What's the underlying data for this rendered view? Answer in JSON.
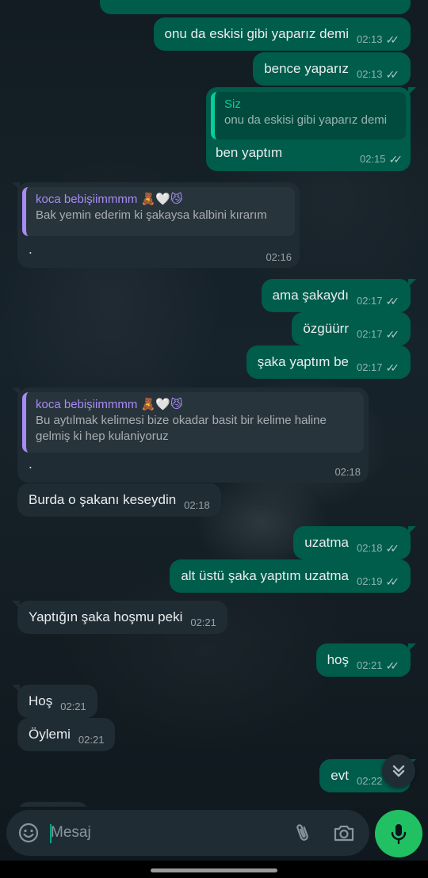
{
  "colors": {
    "outgoing_bubble": "#005c4b",
    "incoming_bubble": "#202c33",
    "accent": "#21c063",
    "contact_name": "#a88bf5",
    "self_name": "#06cf9c"
  },
  "messages": [
    {
      "text": "onu da eskisi gibi yaparız demi",
      "time": "02:13",
      "dir": "out"
    },
    {
      "text": "bence yaparız",
      "time": "02:13",
      "dir": "out"
    },
    {
      "quote_name": "Siz",
      "quote_text": "onu da eskisi gibi yaparız demi",
      "text": "ben yaptım",
      "time": "02:15",
      "dir": "out"
    },
    {
      "quote_name": "koca bebişiimmmm 🧸🤍😼",
      "quote_text": "Bak yemin ederim ki şakaysa kalbini kırarım",
      "text": ".",
      "time": "02:16",
      "dir": "in"
    },
    {
      "text": "ama şakaydı",
      "time": "02:17",
      "dir": "out"
    },
    {
      "text": "özgüürr",
      "time": "02:17",
      "dir": "out"
    },
    {
      "text": "şaka yaptım be",
      "time": "02:17",
      "dir": "out"
    },
    {
      "quote_name": "koca bebişiimmmm 🧸🤍😼",
      "quote_text": "Bu aytılmak kelimesi bize okadar basit bir kelime haline gelmiş ki hep kulaniyoruz",
      "text": ".",
      "time": "02:18",
      "dir": "in"
    },
    {
      "text": "Burda o şakanı keseydin",
      "time": "02:18",
      "dir": "in"
    },
    {
      "text": "uzatma",
      "time": "02:18",
      "dir": "out"
    },
    {
      "text": "alt üstü şaka yaptım uzatma",
      "time": "02:19",
      "dir": "out"
    },
    {
      "text": "Yaptığın şaka hoşmu peki",
      "time": "02:21",
      "dir": "in"
    },
    {
      "text": "hoş",
      "time": "02:21",
      "dir": "out"
    },
    {
      "text": "Hoş",
      "time": "02:21",
      "dir": "in"
    },
    {
      "text": "Öylemi",
      "time": "02:21",
      "dir": "in"
    },
    {
      "text": "evt",
      "time": "02:22",
      "dir": "out"
    }
  ],
  "composer": {
    "placeholder": "Mesaj"
  },
  "icons": {
    "emoji": "emoji-icon",
    "attach": "paperclip-icon",
    "camera": "camera-icon",
    "mic": "microphone-icon",
    "scroll": "double-chevron-down-icon",
    "read": "double-check-icon"
  }
}
